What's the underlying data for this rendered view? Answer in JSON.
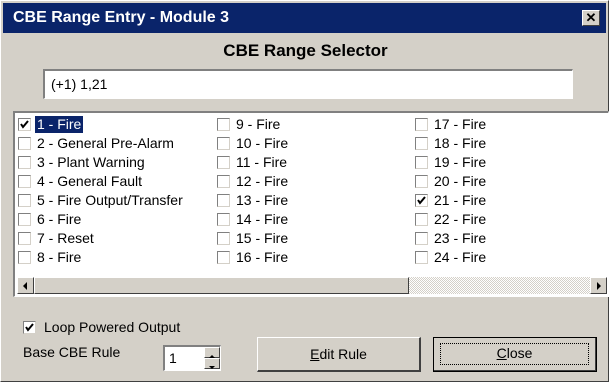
{
  "window": {
    "title": "CBE Range Entry - Module 3",
    "close_glyph": "✕"
  },
  "heading": "CBE Range Selector",
  "range_input": {
    "value": "(+1) 1,21"
  },
  "list": {
    "columns": [
      [
        {
          "label": "1 - Fire",
          "checked": true,
          "selected": true
        },
        {
          "label": "2 - General Pre-Alarm",
          "checked": false
        },
        {
          "label": "3 - Plant Warning",
          "checked": false
        },
        {
          "label": "4 - General Fault",
          "checked": false
        },
        {
          "label": "5 - Fire Output/Transfer",
          "checked": false
        },
        {
          "label": "6 - Fire",
          "checked": false
        },
        {
          "label": "7 - Reset",
          "checked": false
        },
        {
          "label": "8 - Fire",
          "checked": false
        }
      ],
      [
        {
          "label": "9 - Fire",
          "checked": false
        },
        {
          "label": "10 - Fire",
          "checked": false
        },
        {
          "label": "11 - Fire",
          "checked": false
        },
        {
          "label": "12 - Fire",
          "checked": false
        },
        {
          "label": "13 - Fire",
          "checked": false
        },
        {
          "label": "14 - Fire",
          "checked": false
        },
        {
          "label": "15 - Fire",
          "checked": false
        },
        {
          "label": "16 - Fire",
          "checked": false
        }
      ],
      [
        {
          "label": "17 - Fire",
          "checked": false
        },
        {
          "label": "18 - Fire",
          "checked": false
        },
        {
          "label": "19 - Fire",
          "checked": false
        },
        {
          "label": "20 - Fire",
          "checked": false
        },
        {
          "label": "21 - Fire",
          "checked": true
        },
        {
          "label": "22 - Fire",
          "checked": false
        },
        {
          "label": "23 - Fire",
          "checked": false
        },
        {
          "label": "24 - Fire",
          "checked": false
        }
      ]
    ]
  },
  "loop_powered_output": {
    "label": "Loop Powered Output",
    "checked": true
  },
  "base_rule": {
    "label": "Base CBE Rule",
    "value": "1"
  },
  "buttons": {
    "edit_rule": {
      "mnemonic": "E",
      "rest": "dit Rule"
    },
    "close": {
      "mnemonic": "C",
      "rest": "lose"
    }
  },
  "colors": {
    "titlebar": "#0a246a",
    "face": "#d4d0c8",
    "selection": "#0a246a"
  }
}
